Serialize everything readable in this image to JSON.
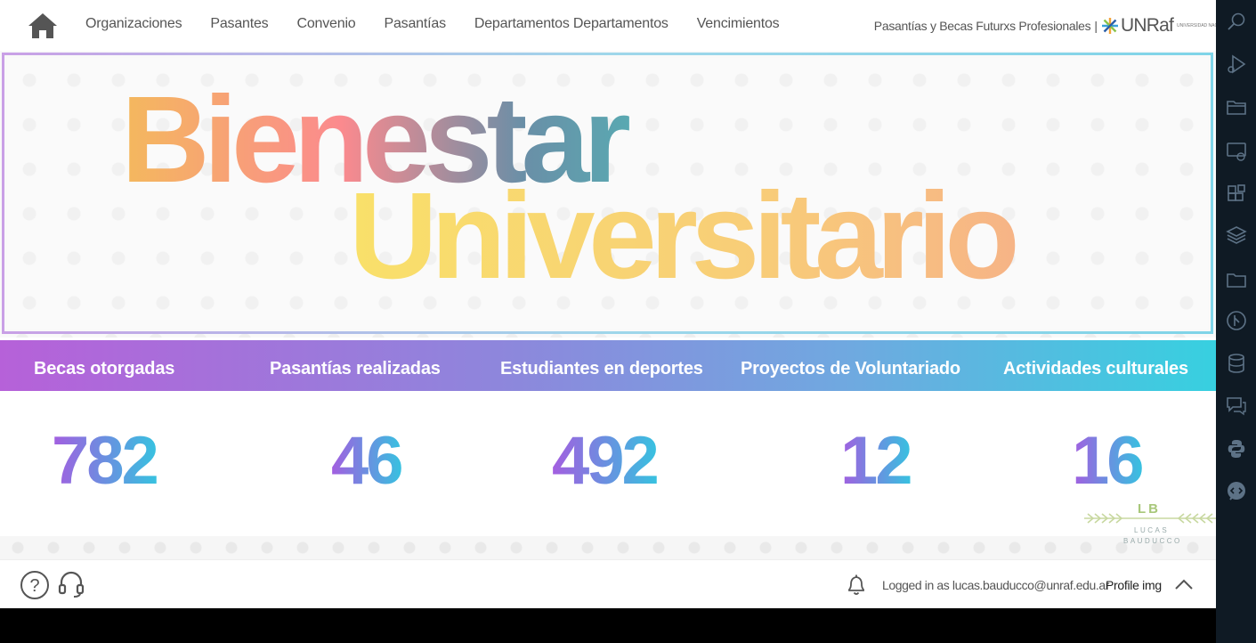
{
  "nav": {
    "items": [
      {
        "label": "Organizaciones"
      },
      {
        "label": "Pasantes"
      },
      {
        "label": "Convenio"
      },
      {
        "label": "Pasantías"
      },
      {
        "label": "Departamentos Departamentos"
      },
      {
        "label": "Vencimientos"
      }
    ],
    "brand_text": "Pasantías y Becas Futurxs Profesionales",
    "brand_sep": "|",
    "logo_word": "UNRaf",
    "logo_sub": "UNIVERSIDAD NACIONAL DE RAFAELA"
  },
  "hero": {
    "line1": "Bienestar",
    "line2": "Universitario"
  },
  "stats": [
    {
      "label": "Becas otorgadas",
      "value": "782"
    },
    {
      "label": "Pasantías realizadas",
      "value": "46"
    },
    {
      "label": "Estudiantes en deportes",
      "value": "492"
    },
    {
      "label": "Proyectos de Voluntariado",
      "value": "12"
    },
    {
      "label": "Actividades culturales",
      "value": "16"
    }
  ],
  "watermark": {
    "initials": "LB",
    "line1": "LUCAS",
    "line2": "BAUDUCCO"
  },
  "footer": {
    "logged_in": "Logged in as lucas.bauducco@unraf.edu.ar",
    "profile": "Profile img"
  },
  "colors": {
    "stats_gradient_start": "#b661d9",
    "stats_gradient_end": "#37d0e0",
    "activity_bar": "#0f1a24"
  },
  "activity_icons": [
    "search-icon",
    "run-debug-icon",
    "explorer-icon",
    "remote-icon",
    "extensions-icon",
    "layers-icon",
    "folder-icon",
    "git-icon",
    "database-icon",
    "chat-icon",
    "python-icon",
    "code-review-icon"
  ]
}
